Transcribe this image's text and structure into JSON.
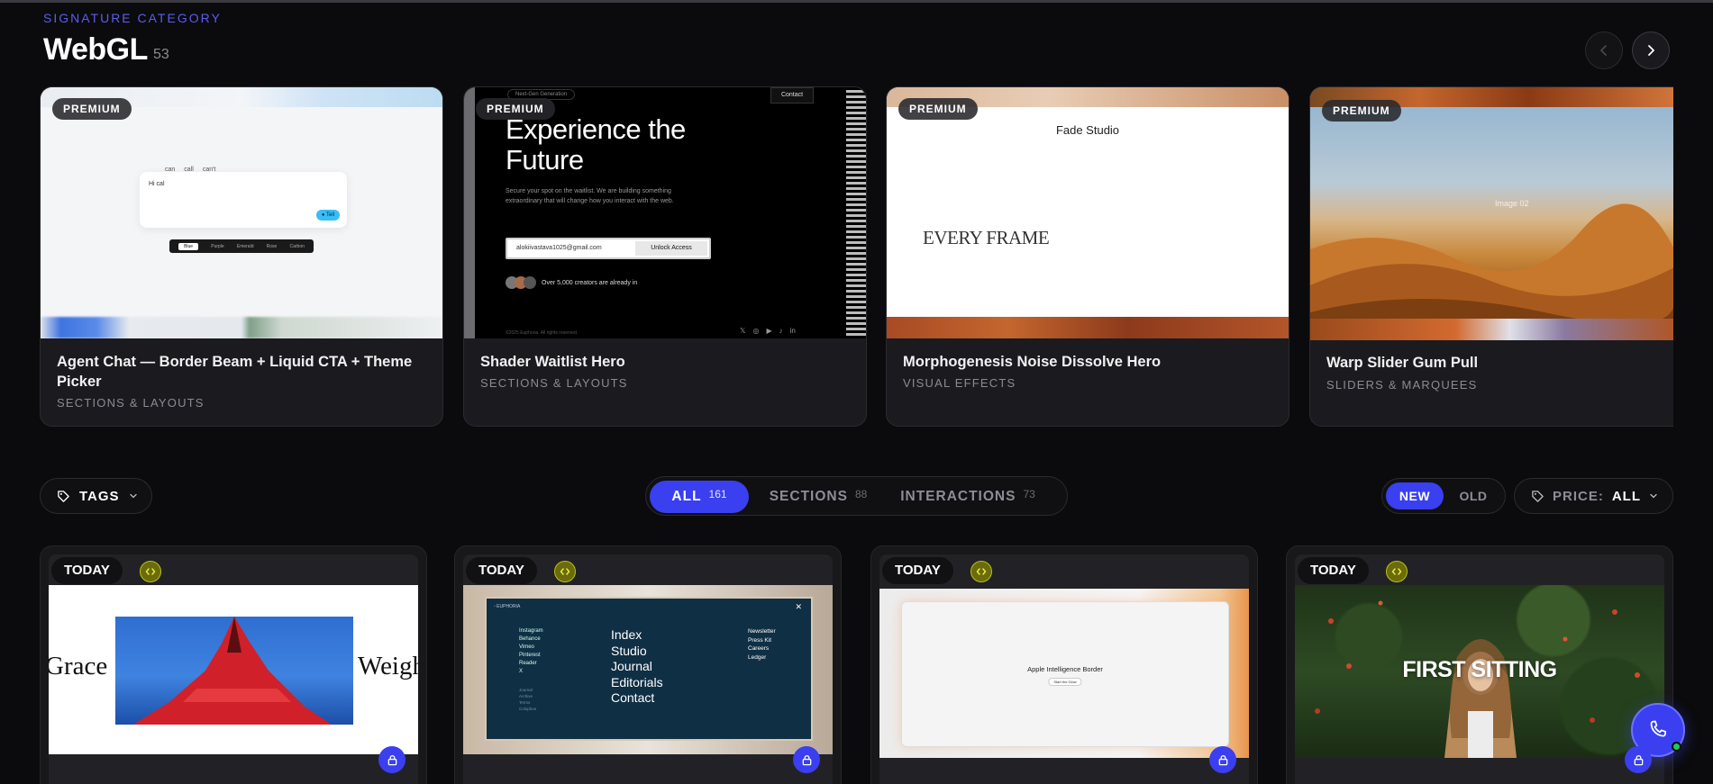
{
  "header": {
    "eyebrow": "SIGNATURE CATEGORY",
    "title": "WebGL",
    "count": "53"
  },
  "featured": [
    {
      "badge": "PREMIUM",
      "title": "Agent Chat — Border Beam + Liquid CTA + Theme Picker",
      "category": "SECTIONS & LAYOUTS",
      "thumb": {
        "chips": [
          "can",
          "call",
          "can't"
        ],
        "input_text": "Hi cal",
        "tabs": [
          "Blue",
          "Purple",
          "Emerald",
          "Rose",
          "Carbon"
        ],
        "send": "● Tell"
      }
    },
    {
      "badge": "PREMIUM",
      "title": "Shader Waitlist Hero",
      "category": "SECTIONS & LAYOUTS",
      "thumb": {
        "top_pill": "Next-Gen Generation",
        "contact": "Contact",
        "headline_1": "Experience the",
        "headline_2": "Future",
        "body": "Secure your spot on the waitlist. We are building something extraordinary that will change how you interact with the web.",
        "email": "alokiivastava1025@gmail.com",
        "cta": "Unlock Access",
        "social_proof": "Over 5,000 creators are already in",
        "footer": "©2025 Euphoria. All rights reserved."
      }
    },
    {
      "badge": "PREMIUM",
      "title": "Morphogenesis Noise Dissolve Hero",
      "category": "VISUAL EFFECTS",
      "thumb": {
        "studio": "Fade Studio",
        "headline": "EVERY FRAME"
      }
    },
    {
      "badge": "PREMIUM",
      "title": "Warp Slider Gum Pull",
      "category": "SLIDERS & MARQUEES",
      "thumb": {
        "label": "Image 02"
      }
    }
  ],
  "filters": {
    "tags_label": "TAGS",
    "segments": [
      {
        "label": "ALL",
        "count": "161",
        "active": true
      },
      {
        "label": "SECTIONS",
        "count": "88",
        "active": false
      },
      {
        "label": "INTERACTIONS",
        "count": "73",
        "active": false
      }
    ],
    "age": [
      {
        "label": "NEW",
        "active": true
      },
      {
        "label": "OLD",
        "active": false
      }
    ],
    "price_key": "PRICE:",
    "price_value": "ALL"
  },
  "grid": [
    {
      "badge": "TODAY",
      "thumb": {
        "left": "Grace",
        "right": "Weigh"
      }
    },
    {
      "badge": "TODAY",
      "thumb": {
        "logo": "▫ EUPHORIA",
        "left_links": [
          "Instagram",
          "Behance",
          "Vimeo",
          "Pinterest",
          "Reader",
          "X"
        ],
        "small_links": [
          "Journal",
          "Archive",
          "Terms",
          "Colophon"
        ],
        "main_links": [
          "Index",
          "Studio",
          "Journal",
          "Editorials",
          "Contact"
        ],
        "right_links": [
          "Newsletter",
          "Press Kit",
          "Careers",
          "Ledger"
        ]
      }
    },
    {
      "badge": "TODAY",
      "thumb": {
        "title": "Apple Intelligence Border",
        "button": "Start the Glow"
      }
    },
    {
      "badge": "TODAY",
      "thumb": {
        "headline": "FIRST SITTING"
      }
    }
  ],
  "colors": {
    "background": "#0b0b0d",
    "accent": "#3a3ff0",
    "eyebrow": "#5b5cf0",
    "card": "#1b1b1f",
    "code_badge": "#b8c21a"
  },
  "icons": {
    "prev": "chevron-left-icon",
    "next": "chevron-right-icon",
    "tag": "tag-icon",
    "caret": "chevron-down-icon",
    "code": "code-icon",
    "lock": "lock-icon",
    "phone": "phone-icon"
  }
}
